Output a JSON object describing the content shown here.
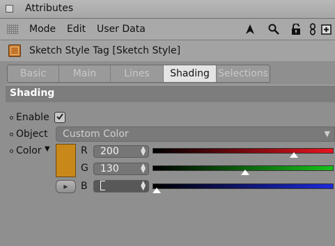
{
  "window": {
    "title": "Attributes"
  },
  "menubar": {
    "items": [
      "Mode",
      "Edit",
      "User Data"
    ]
  },
  "toolbar_icons": [
    "pointer-arrow-icon",
    "search-icon",
    "lock-icon",
    "link-icon",
    "new-panel-icon"
  ],
  "object": {
    "name": "Sketch Style Tag [Sketch Style]"
  },
  "tabs": [
    {
      "label": "Basic",
      "active": false
    },
    {
      "label": "Main",
      "active": false
    },
    {
      "label": "Lines",
      "active": false
    },
    {
      "label": "Shading",
      "active": true
    },
    {
      "label": "Selections",
      "active": false
    }
  ],
  "section": {
    "title": "Shading"
  },
  "params": {
    "enable": {
      "label": "Enable",
      "checked": true
    },
    "object": {
      "label": "Object",
      "value": "Custom Color"
    },
    "color": {
      "label": "Color",
      "hex": "#c8881a",
      "r": {
        "label": "R",
        "value": "200",
        "fraction": 0.78
      },
      "g": {
        "label": "G",
        "value": "130",
        "fraction": 0.51
      },
      "b": {
        "label": "B",
        "value": "0",
        "fraction": 0.0
      }
    }
  },
  "colors": {
    "red": "#e8131e",
    "green": "#17c21b",
    "blue": "#1d2ad8"
  }
}
